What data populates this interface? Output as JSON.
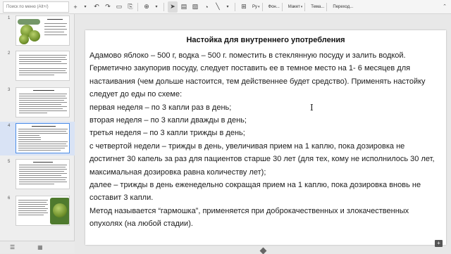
{
  "toolbar": {
    "search_placeholder": "Поиск по меню (Alt+/)",
    "background_label": "Фон...",
    "layout_label": "Макет",
    "theme_label": "Тема...",
    "transition_label": "Переход..."
  },
  "slide": {
    "title": "Настойка для внутреннего употребления",
    "paragraphs": [
      "Адамово яблоко – 500 г, водка – 500 г. поместить в стеклянную посуду и залить водкой. Герметично закупорив посуду, следует поставить ее в темное место на 1- 6 месяцев для настаивания (чем дольше настоится, тем действеннее будет средство). Применять настойку следует до еды по схеме:",
      "первая неделя – по 3 капли раз в день;",
      "вторая неделя – по 3 капли дважды в день;",
      "третья неделя – по 3 капли трижды в день;",
      "с четвертой недели – трижды в день, увеличивая прием на 1 каплю, пока дозировка не достигнет 30 капель за раз для пациентов старше 30 лет (для тех, кому не исполнилось 30 лет, максимальная дозировка равна количеству лет);",
      "далее – трижды в день еженедельно сокращая прием на 1 каплю, пока дозировка вновь не составит 3 капли.",
      "Метод называется “гармошка”, применяется при доброкачественных и злокачественных опухолях (на любой стадии)."
    ]
  },
  "thumbnails": [
    {
      "num": "1",
      "selected": false
    },
    {
      "num": "2",
      "selected": false
    },
    {
      "num": "3",
      "selected": false
    },
    {
      "num": "4",
      "selected": true
    },
    {
      "num": "5",
      "selected": false
    },
    {
      "num": "6",
      "selected": false
    }
  ]
}
